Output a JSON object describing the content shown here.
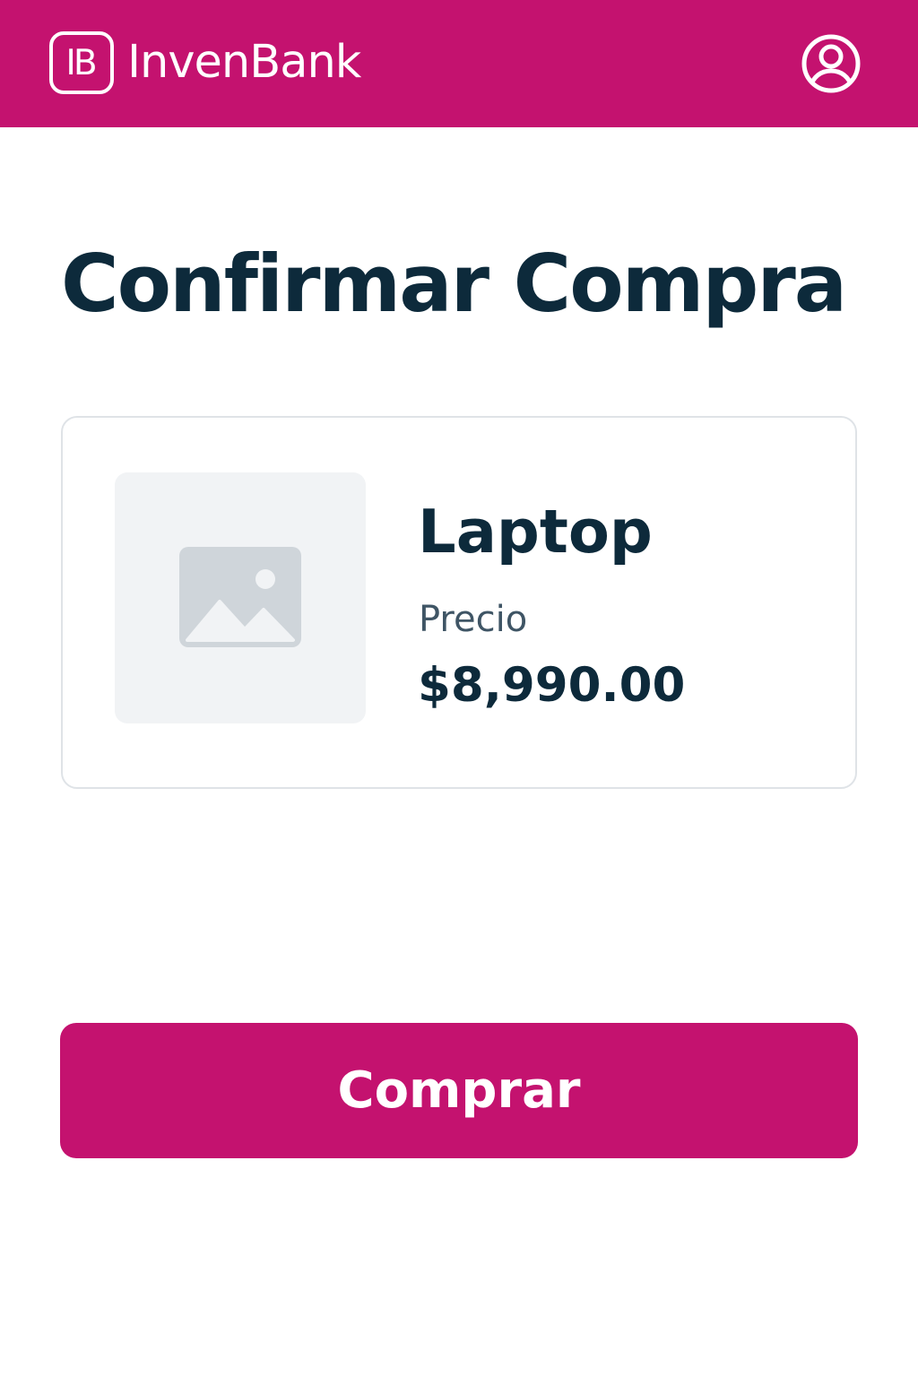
{
  "header": {
    "logo_mark": "IB",
    "brand_name": "InvenBank",
    "profile_icon": "user-circle-icon"
  },
  "main": {
    "title": "Confirmar Compra",
    "product": {
      "image_icon": "image-placeholder-icon",
      "name": "Laptop",
      "price_label": "Precio",
      "price_value": "$8,990.00"
    },
    "buy_button_label": "Comprar"
  },
  "colors": {
    "brand": "#c4126f",
    "text_primary": "#0d2a3b",
    "text_secondary": "#3f5565",
    "card_border": "#dfe3e7",
    "thumb_bg": "#f1f3f5",
    "icon_placeholder": "#cfd5da"
  }
}
